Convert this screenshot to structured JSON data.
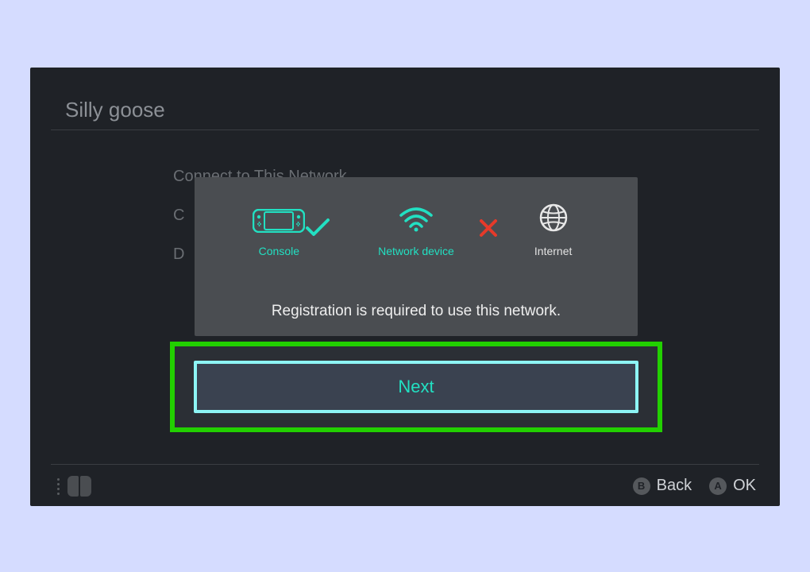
{
  "header": {
    "title": "Silly goose"
  },
  "background_rows": [
    "Connect to This Network",
    "C",
    "D"
  ],
  "modal": {
    "steps": {
      "console": {
        "label": "Console"
      },
      "network_device": {
        "label": "Network device"
      },
      "internet": {
        "label": "Internet"
      }
    },
    "connection": {
      "console_to_network": "ok",
      "network_to_internet": "fail"
    },
    "message": "Registration is required to use this network.",
    "primary_button": "Next"
  },
  "footer": {
    "back": {
      "button": "B",
      "label": "Back"
    },
    "ok": {
      "button": "A",
      "label": "OK"
    }
  }
}
